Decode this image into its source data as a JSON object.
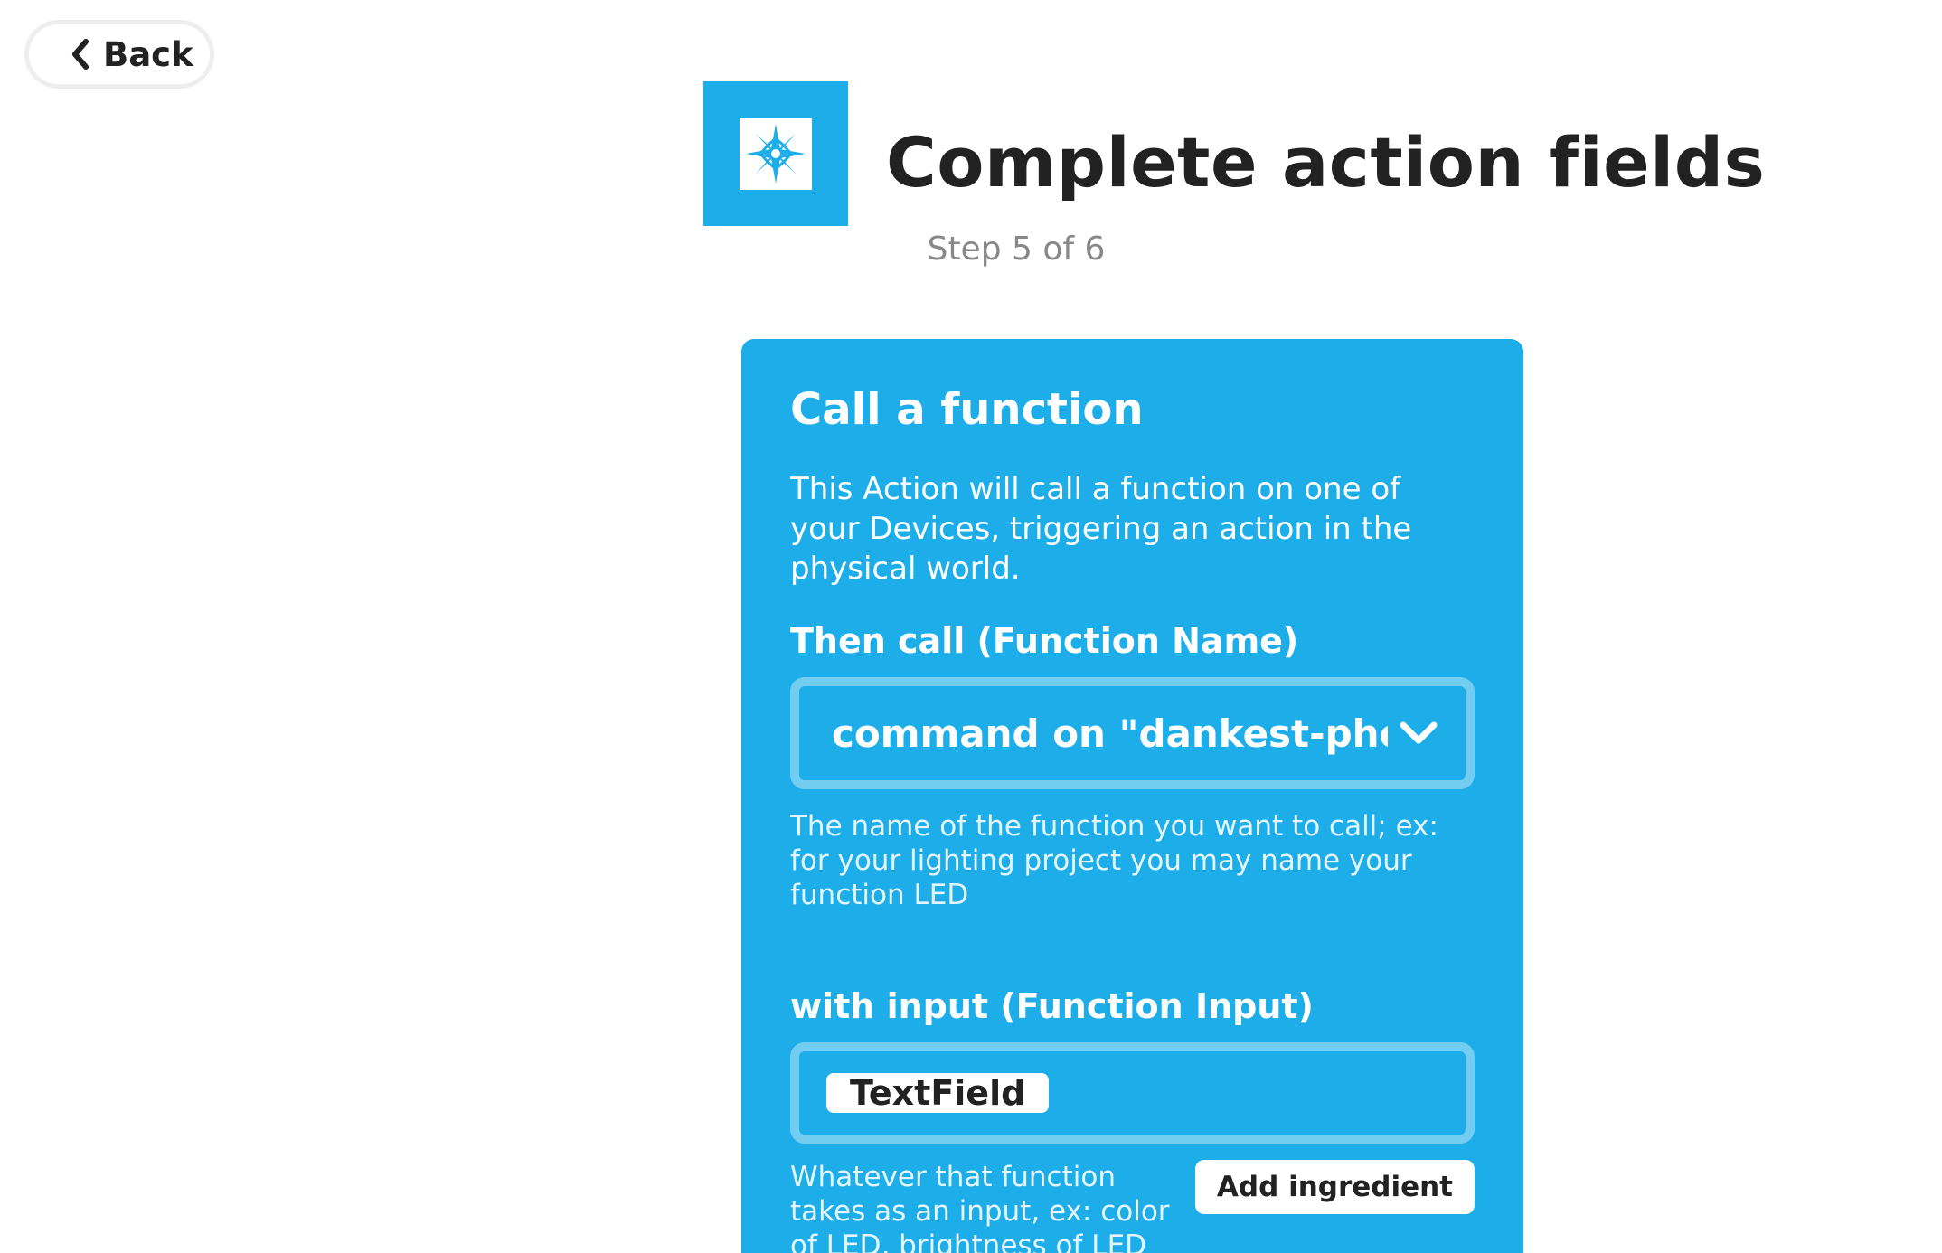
{
  "nav": {
    "back_label": "Back"
  },
  "header": {
    "title": "Complete action fields",
    "step": "Step 5 of 6",
    "service_logo_icon": "compass-star-icon",
    "brand_color": "#1daee9"
  },
  "card": {
    "title": "Call a function",
    "description": "This Action will call a function on one of your Devices, triggering an action in the physical world.",
    "function_name": {
      "label": "Then call (Function Name)",
      "selected_value": "command on \"dankest-photo",
      "help": "The name of the function you want to call; ex: for your lighting project you may name your function LED"
    },
    "function_input": {
      "label": "with input (Function Input)",
      "ingredient": "TextField",
      "help": "Whatever that function takes as an input, ex: color of LED, brightness of LED",
      "add_ingredient_label": "Add ingredient"
    }
  }
}
